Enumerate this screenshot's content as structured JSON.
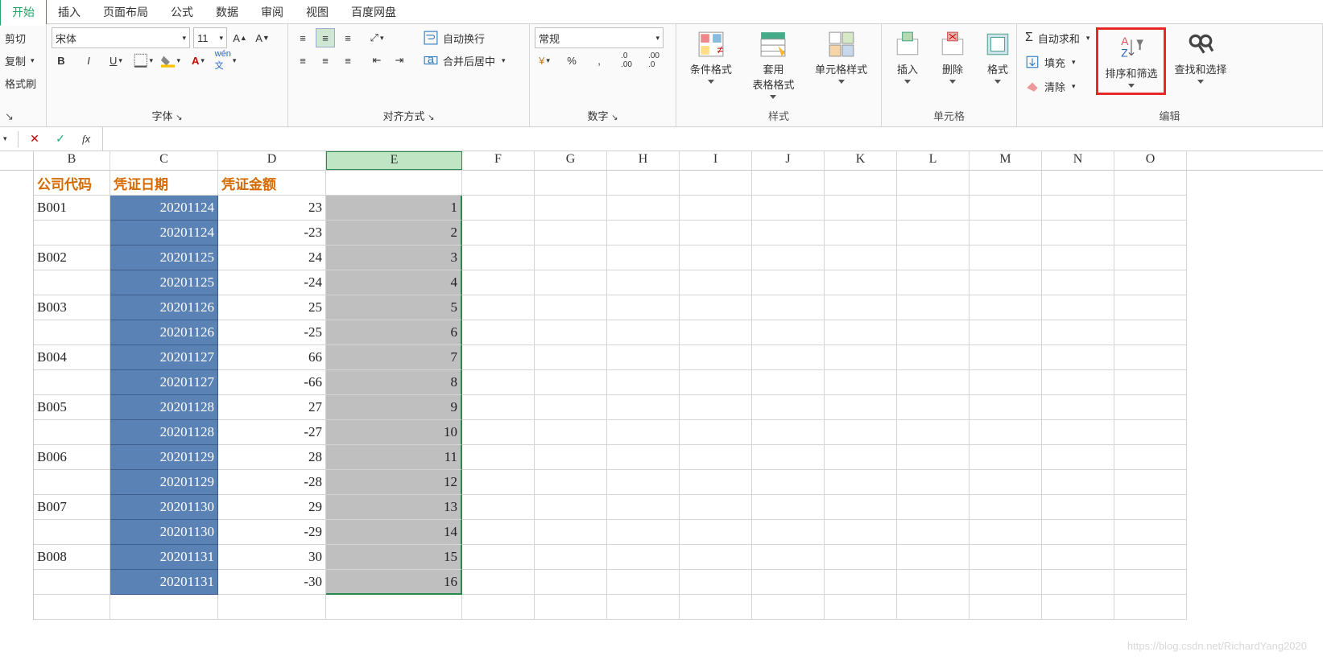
{
  "tabs": [
    "开始",
    "插入",
    "页面布局",
    "公式",
    "数据",
    "审阅",
    "视图",
    "百度网盘"
  ],
  "active_tab": 0,
  "clipboard": {
    "cut": "剪切",
    "copy": "复制",
    "paint": "格式刷"
  },
  "font": {
    "name": "宋体",
    "size": "11"
  },
  "groups": {
    "font": "字体",
    "align": "对齐方式",
    "number": "数字",
    "style": "样式",
    "cells": "单元格",
    "edit": "编辑"
  },
  "align": {
    "wrap": "自动换行",
    "merge": "合并后居中"
  },
  "number": {
    "format": "常规"
  },
  "style": {
    "cond": "条件格式",
    "table": "套用\n表格格式",
    "cell": "单元格样式"
  },
  "cells": {
    "insert": "插入",
    "delete": "删除",
    "format": "格式"
  },
  "edit": {
    "sum": "自动求和",
    "fill": "填充",
    "clear": "清除",
    "sort": "排序和筛选",
    "find": "查找和选择"
  },
  "columns": [
    "B",
    "C",
    "D",
    "E",
    "F",
    "G",
    "H",
    "I",
    "J",
    "K",
    "L",
    "M",
    "N",
    "O"
  ],
  "header_row": {
    "B": "公司代码",
    "C": "凭证日期",
    "D": "凭证金额",
    "E": ""
  },
  "data_rows": [
    {
      "B": "B001",
      "C": "20201124",
      "D": "23",
      "E": "1"
    },
    {
      "B": "",
      "C": "20201124",
      "D": "-23",
      "E": "2"
    },
    {
      "B": "B002",
      "C": "20201125",
      "D": "24",
      "E": "3"
    },
    {
      "B": "",
      "C": "20201125",
      "D": "-24",
      "E": "4"
    },
    {
      "B": "B003",
      "C": "20201126",
      "D": "25",
      "E": "5"
    },
    {
      "B": "",
      "C": "20201126",
      "D": "-25",
      "E": "6"
    },
    {
      "B": "B004",
      "C": "20201127",
      "D": "66",
      "E": "7"
    },
    {
      "B": "",
      "C": "20201127",
      "D": "-66",
      "E": "8"
    },
    {
      "B": "B005",
      "C": "20201128",
      "D": "27",
      "E": "9"
    },
    {
      "B": "",
      "C": "20201128",
      "D": "-27",
      "E": "10"
    },
    {
      "B": "B006",
      "C": "20201129",
      "D": "28",
      "E": "11"
    },
    {
      "B": "",
      "C": "20201129",
      "D": "-28",
      "E": "12"
    },
    {
      "B": "B007",
      "C": "20201130",
      "D": "29",
      "E": "13"
    },
    {
      "B": "",
      "C": "20201130",
      "D": "-29",
      "E": "14"
    },
    {
      "B": "B008",
      "C": "20201131",
      "D": "30",
      "E": "15"
    },
    {
      "B": "",
      "C": "20201131",
      "D": "-30",
      "E": "16"
    }
  ],
  "watermark": "https://blog.csdn.net/RichardYang2020"
}
